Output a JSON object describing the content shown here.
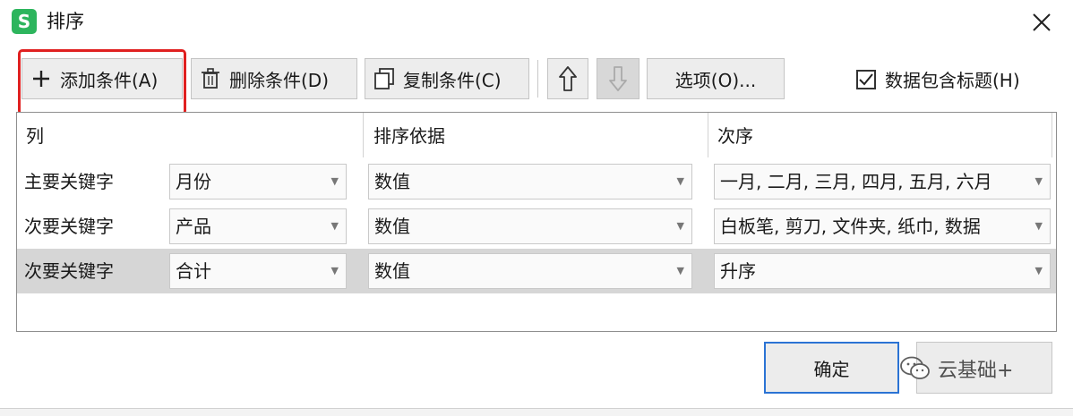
{
  "window": {
    "title": "排序",
    "app_icon_letter": "S"
  },
  "toolbar": {
    "add_label": "添加条件(A)",
    "delete_label": "删除条件(D)",
    "copy_label": "复制条件(C)",
    "options_label": "选项(O)...",
    "header_checkbox_label": "数据包含标题(H)",
    "header_checkbox_checked": true
  },
  "grid": {
    "headers": {
      "column": "列",
      "sort_on": "排序依据",
      "order": "次序"
    },
    "rows": [
      {
        "label": "主要关键字",
        "column": "月份",
        "sort_on": "数值",
        "order": "一月, 二月, 三月, 四月, 五月, 六月"
      },
      {
        "label": "次要关键字",
        "column": "产品",
        "sort_on": "数值",
        "order": "白板笔, 剪刀, 文件夹, 纸巾, 数据"
      },
      {
        "label": "次要关键字",
        "column": "合计",
        "sort_on": "数值",
        "order": "升序"
      }
    ]
  },
  "footer": {
    "ok_label": "确定"
  },
  "watermark": {
    "text": "云基础+"
  },
  "colors": {
    "highlight_border": "#e02020",
    "default_button_border": "#2b73d4",
    "app_icon": "#2db55d",
    "selected_row": "#d6d6d6"
  }
}
